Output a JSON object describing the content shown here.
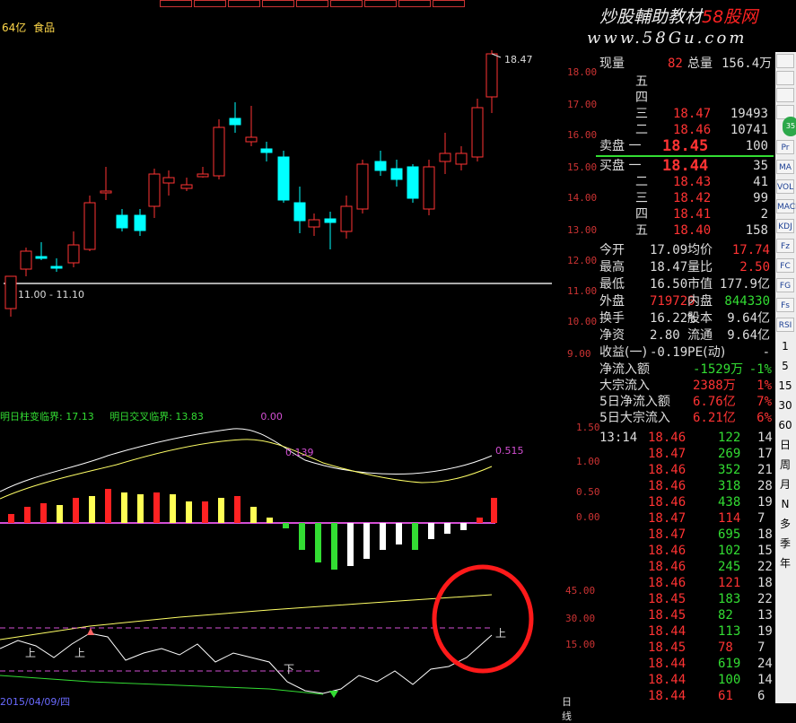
{
  "header": {
    "cap_label": "64亿",
    "sector": "食品"
  },
  "watermark": {
    "line1_a": "炒股輔助教材",
    "line1_b": "58股网",
    "line2": "www.58Gu.com"
  },
  "price_axis": [
    "18.00",
    "17.00",
    "16.00",
    "15.00",
    "14.00",
    "13.00",
    "12.00",
    "11.00",
    "10.00",
    "9.00"
  ],
  "price_annotations": {
    "high": "18.47",
    "range": "11.00 - 11.10"
  },
  "indicator": {
    "label1": "明日柱变临界: 17.13",
    "label2": "明日交叉临界: 13.83",
    "value": "0.00",
    "val_a": "0.139",
    "val_b": "0.515"
  },
  "macd_axis": [
    "1.50",
    "1.00",
    "0.50",
    "0.00"
  ],
  "kdj_axis": [
    "45.00",
    "30.00",
    "15.00"
  ],
  "kdj_marks": {
    "up": "上",
    "down": "下"
  },
  "bottom_date": "2015/04/09/四",
  "bottom_tab": "日线",
  "quote": {
    "now_label": "现量",
    "now_val": "82",
    "vol_label": "总量",
    "vol_val": "156.4万",
    "sell_levels": [
      {
        "label": "五",
        "price": "",
        "vol": ""
      },
      {
        "label": "四",
        "price": "",
        "vol": ""
      },
      {
        "label": "三",
        "price": "18.47",
        "vol": "19493"
      },
      {
        "label": "二",
        "price": "18.46",
        "vol": "10741"
      },
      {
        "label": "卖盘 一",
        "price": "18.45",
        "vol": "100"
      }
    ],
    "buy_levels": [
      {
        "label": "买盘 一",
        "price": "18.44",
        "vol": "35"
      },
      {
        "label": "二",
        "price": "18.43",
        "vol": "41"
      },
      {
        "label": "三",
        "price": "18.42",
        "vol": "99"
      },
      {
        "label": "四",
        "price": "18.41",
        "vol": "2"
      },
      {
        "label": "五",
        "price": "18.40",
        "vol": "158"
      }
    ],
    "stats": [
      {
        "l1": "今开",
        "v1": "17.09",
        "l2": "均价",
        "v2": "17.74"
      },
      {
        "l1": "最高",
        "v1": "18.47",
        "l2": "量比",
        "v2": "2.50"
      },
      {
        "l1": "最低",
        "v1": "16.50",
        "l2": "市值",
        "v2": "177.9亿"
      },
      {
        "l1": "外盘",
        "v1": "719720",
        "l2": "内盘",
        "v2": "844330"
      },
      {
        "l1": "换手",
        "v1": "16.22%",
        "l2": "股本",
        "v2": "9.64亿"
      },
      {
        "l1": "净资",
        "v1": "2.80",
        "l2": "流通",
        "v2": "9.64亿"
      },
      {
        "l1": "收益(一)",
        "v1": "-0.19",
        "l2": "PE(动)",
        "v2": "-"
      }
    ],
    "flows": [
      {
        "label": "净流入额",
        "val": "-1529万",
        "pct": "-1%"
      },
      {
        "label": "大宗流入",
        "val": "2388万",
        "pct": "1%"
      },
      {
        "label": "5日净流入额",
        "val": "6.76亿",
        "pct": "7%"
      },
      {
        "label": "5日大宗流入",
        "val": "6.21亿",
        "pct": "6%"
      }
    ],
    "ticks": [
      {
        "t": "13:14",
        "p": "18.46",
        "v": "122",
        "n": "14"
      },
      {
        "t": "",
        "p": "18.47",
        "v": "269",
        "n": "17"
      },
      {
        "t": "",
        "p": "18.46",
        "v": "352",
        "n": "21"
      },
      {
        "t": "",
        "p": "18.46",
        "v": "318",
        "n": "28"
      },
      {
        "t": "",
        "p": "18.46",
        "v": "438",
        "n": "19"
      },
      {
        "t": "",
        "p": "18.47",
        "v": "114",
        "n": "7"
      },
      {
        "t": "",
        "p": "18.47",
        "v": "695",
        "n": "18"
      },
      {
        "t": "",
        "p": "18.46",
        "v": "102",
        "n": "15"
      },
      {
        "t": "",
        "p": "18.46",
        "v": "245",
        "n": "22"
      },
      {
        "t": "",
        "p": "18.46",
        "v": "121",
        "n": "18"
      },
      {
        "t": "",
        "p": "18.45",
        "v": "183",
        "n": "22"
      },
      {
        "t": "",
        "p": "18.45",
        "v": "82",
        "n": "13"
      },
      {
        "t": "",
        "p": "18.44",
        "v": "113",
        "n": "19"
      },
      {
        "t": "",
        "p": "18.45",
        "v": "78",
        "n": "7"
      },
      {
        "t": "",
        "p": "18.44",
        "v": "619",
        "n": "24"
      },
      {
        "t": "",
        "p": "18.44",
        "v": "100",
        "n": "14"
      },
      {
        "t": "",
        "p": "18.44",
        "v": "61",
        "n": "6"
      }
    ]
  },
  "tools": [
    "Pr",
    "MA",
    "VOL",
    "MACD",
    "KDJ",
    "Fz",
    "FC",
    "FG",
    "Fs",
    "RSI"
  ],
  "period_tabs": [
    "1",
    "5",
    "15",
    "30",
    "60",
    "日",
    "周",
    "月",
    "N",
    "多",
    "季",
    "年"
  ],
  "colors": {
    "up": "#ff3333",
    "down": "#00ffff",
    "ma": "#ffffff",
    "highlight": "#ff2222"
  }
}
